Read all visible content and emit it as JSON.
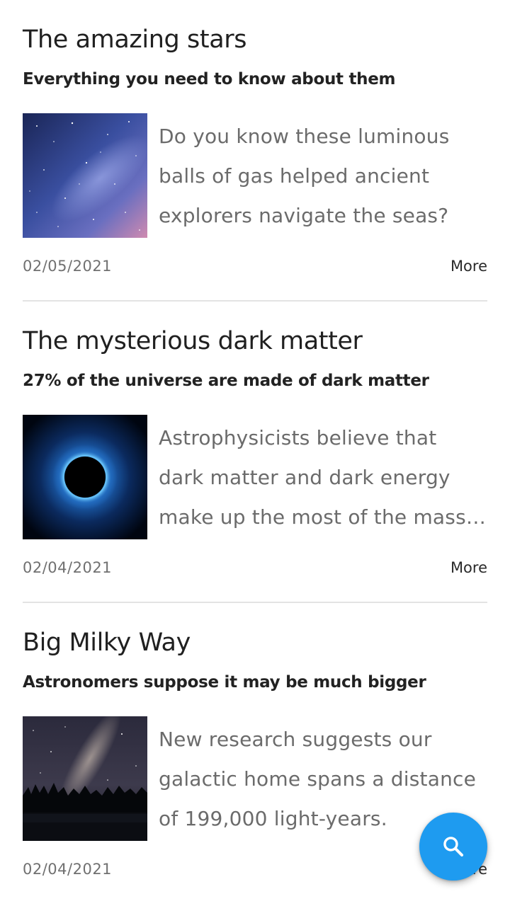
{
  "articles": [
    {
      "title": "The amazing stars",
      "subtitle": "Everything you need to know about them",
      "excerpt_lines": [
        "Do you know these luminous",
        "balls of gas helped ancient",
        "explorers navigate the seas?"
      ],
      "date": "02/05/2021",
      "more_label": "More",
      "image": "starry-sky-image"
    },
    {
      "title": "The mysterious dark matter",
      "subtitle": "27% of the universe are made of dark matter",
      "excerpt_lines": [
        "Astrophysicists believe that",
        "dark matter and dark energy",
        "make up the most of the mass…"
      ],
      "date": "02/04/2021",
      "more_label": "More",
      "image": "black-hole-image"
    },
    {
      "title": "Big Milky Way",
      "subtitle": "Astronomers suppose it may be much bigger",
      "excerpt_lines": [
        "New research suggests our",
        "galactic home spans a distance",
        "of 199,000 light-years."
      ],
      "date": "02/04/2021",
      "more_label": "More",
      "image": "milky-way-image"
    }
  ],
  "fab": {
    "icon": "search-icon",
    "color": "#1e9bf0"
  }
}
